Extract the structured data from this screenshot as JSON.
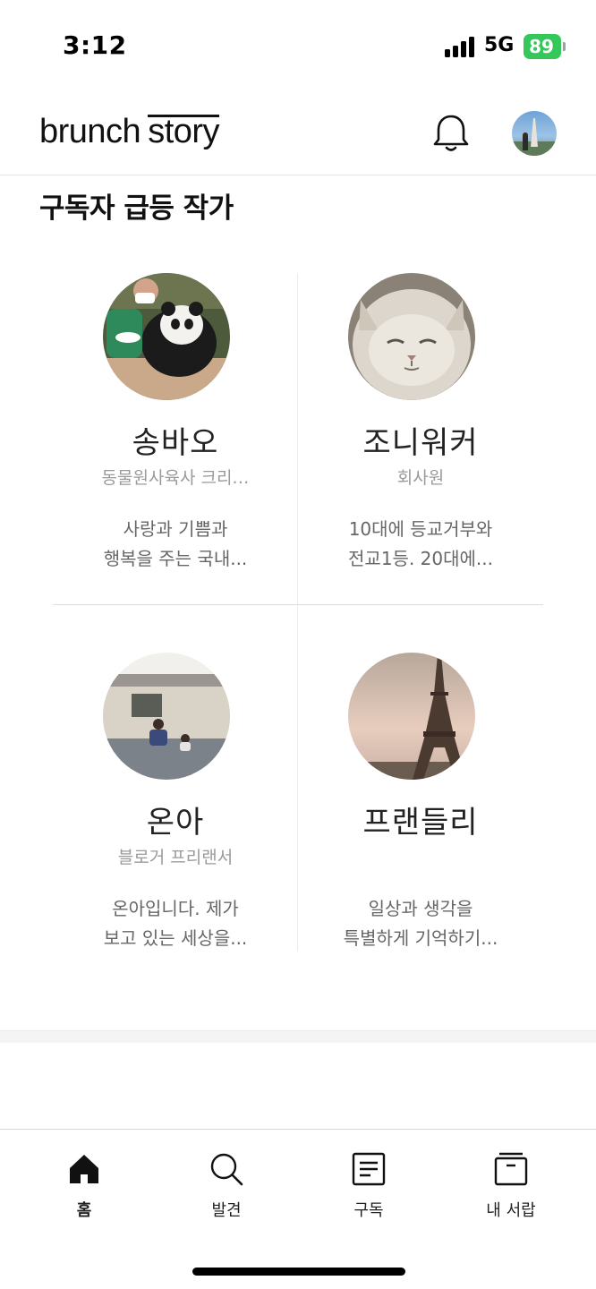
{
  "status_bar": {
    "time": "3:12",
    "network": "5G",
    "battery": "89"
  },
  "header": {
    "logo_part1": "brunch",
    "logo_part2": "story",
    "icons": [
      "bell-icon",
      "avatar"
    ]
  },
  "section": {
    "title": "구독자 급등 작가"
  },
  "authors": [
    {
      "name": "송바오",
      "job": "동물원사육사 크리…",
      "desc_line1": "사랑과 기쁨과",
      "desc_line2": "행복을 주는 국내..."
    },
    {
      "name": "조니워커",
      "job": "회사원",
      "desc_line1": "10대에 등교거부와",
      "desc_line2": "전교1등. 20대에..."
    },
    {
      "name": "온아",
      "job": "블로거 프리랜서",
      "desc_line1": "온아입니다. 제가",
      "desc_line2": "보고 있는 세상을..."
    },
    {
      "name": "프랜들리",
      "job": "",
      "desc_line1": "일상과 생각을",
      "desc_line2": "특별하게 기억하기..."
    }
  ],
  "tab_bar": {
    "tabs": [
      {
        "label": "홈",
        "icon": "home-icon",
        "active": true
      },
      {
        "label": "발견",
        "icon": "search-icon",
        "active": false
      },
      {
        "label": "구독",
        "icon": "document-icon",
        "active": false
      },
      {
        "label": "내 서랍",
        "icon": "drawer-icon",
        "active": false
      }
    ]
  },
  "colors": {
    "battery": "#34c759",
    "text": "#111111",
    "muted": "#9a9a9a"
  }
}
